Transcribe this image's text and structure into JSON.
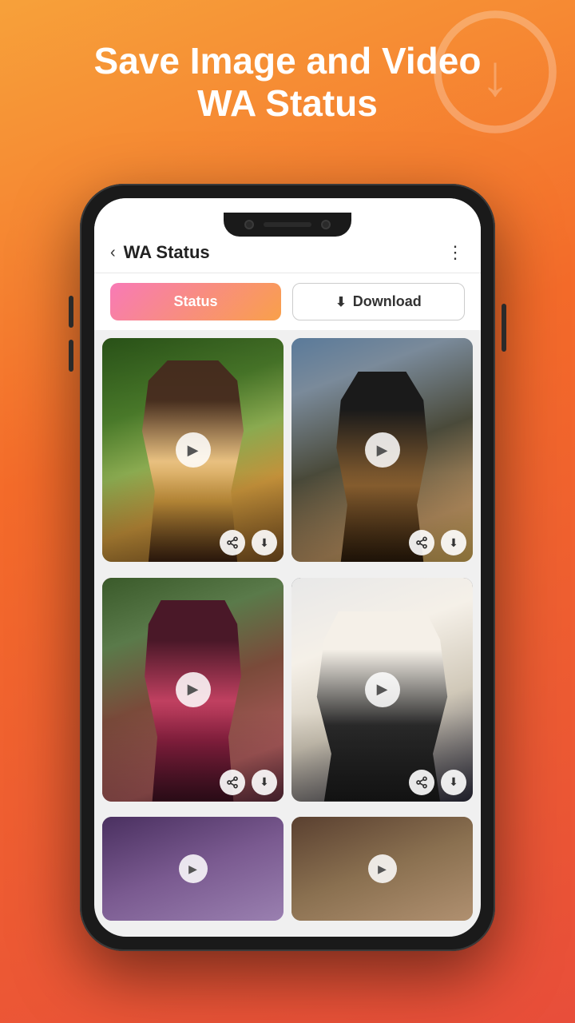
{
  "page": {
    "header_title": "Save Image and Video\nWA Status",
    "bg_icon": "download"
  },
  "app": {
    "title": "WA Status",
    "back_label": "‹",
    "more_icon": "⋮",
    "tabs": [
      {
        "id": "status",
        "label": "Status",
        "active": true
      },
      {
        "id": "download",
        "label": "Download",
        "active": false
      }
    ],
    "media_items": [
      {
        "id": 1,
        "type": "video",
        "col": 1,
        "row": 1
      },
      {
        "id": 2,
        "type": "video",
        "col": 2,
        "row": 1
      },
      {
        "id": 3,
        "type": "video",
        "col": 1,
        "row": 2
      },
      {
        "id": 4,
        "type": "video",
        "col": 2,
        "row": 2
      },
      {
        "id": 5,
        "type": "image",
        "col": 1,
        "row": 3
      },
      {
        "id": 6,
        "type": "image",
        "col": 2,
        "row": 3
      }
    ],
    "actions": {
      "share_icon": "share",
      "download_icon": "⬇",
      "play_icon": "▶"
    }
  },
  "colors": {
    "bg_gradient_start": "#f7a13a",
    "bg_gradient_end": "#e84e3a",
    "tab_active_start": "#f87ab6",
    "tab_active_end": "#f9a04a",
    "tab_inactive_bg": "#ffffff",
    "tab_inactive_border": "#cccccc"
  }
}
